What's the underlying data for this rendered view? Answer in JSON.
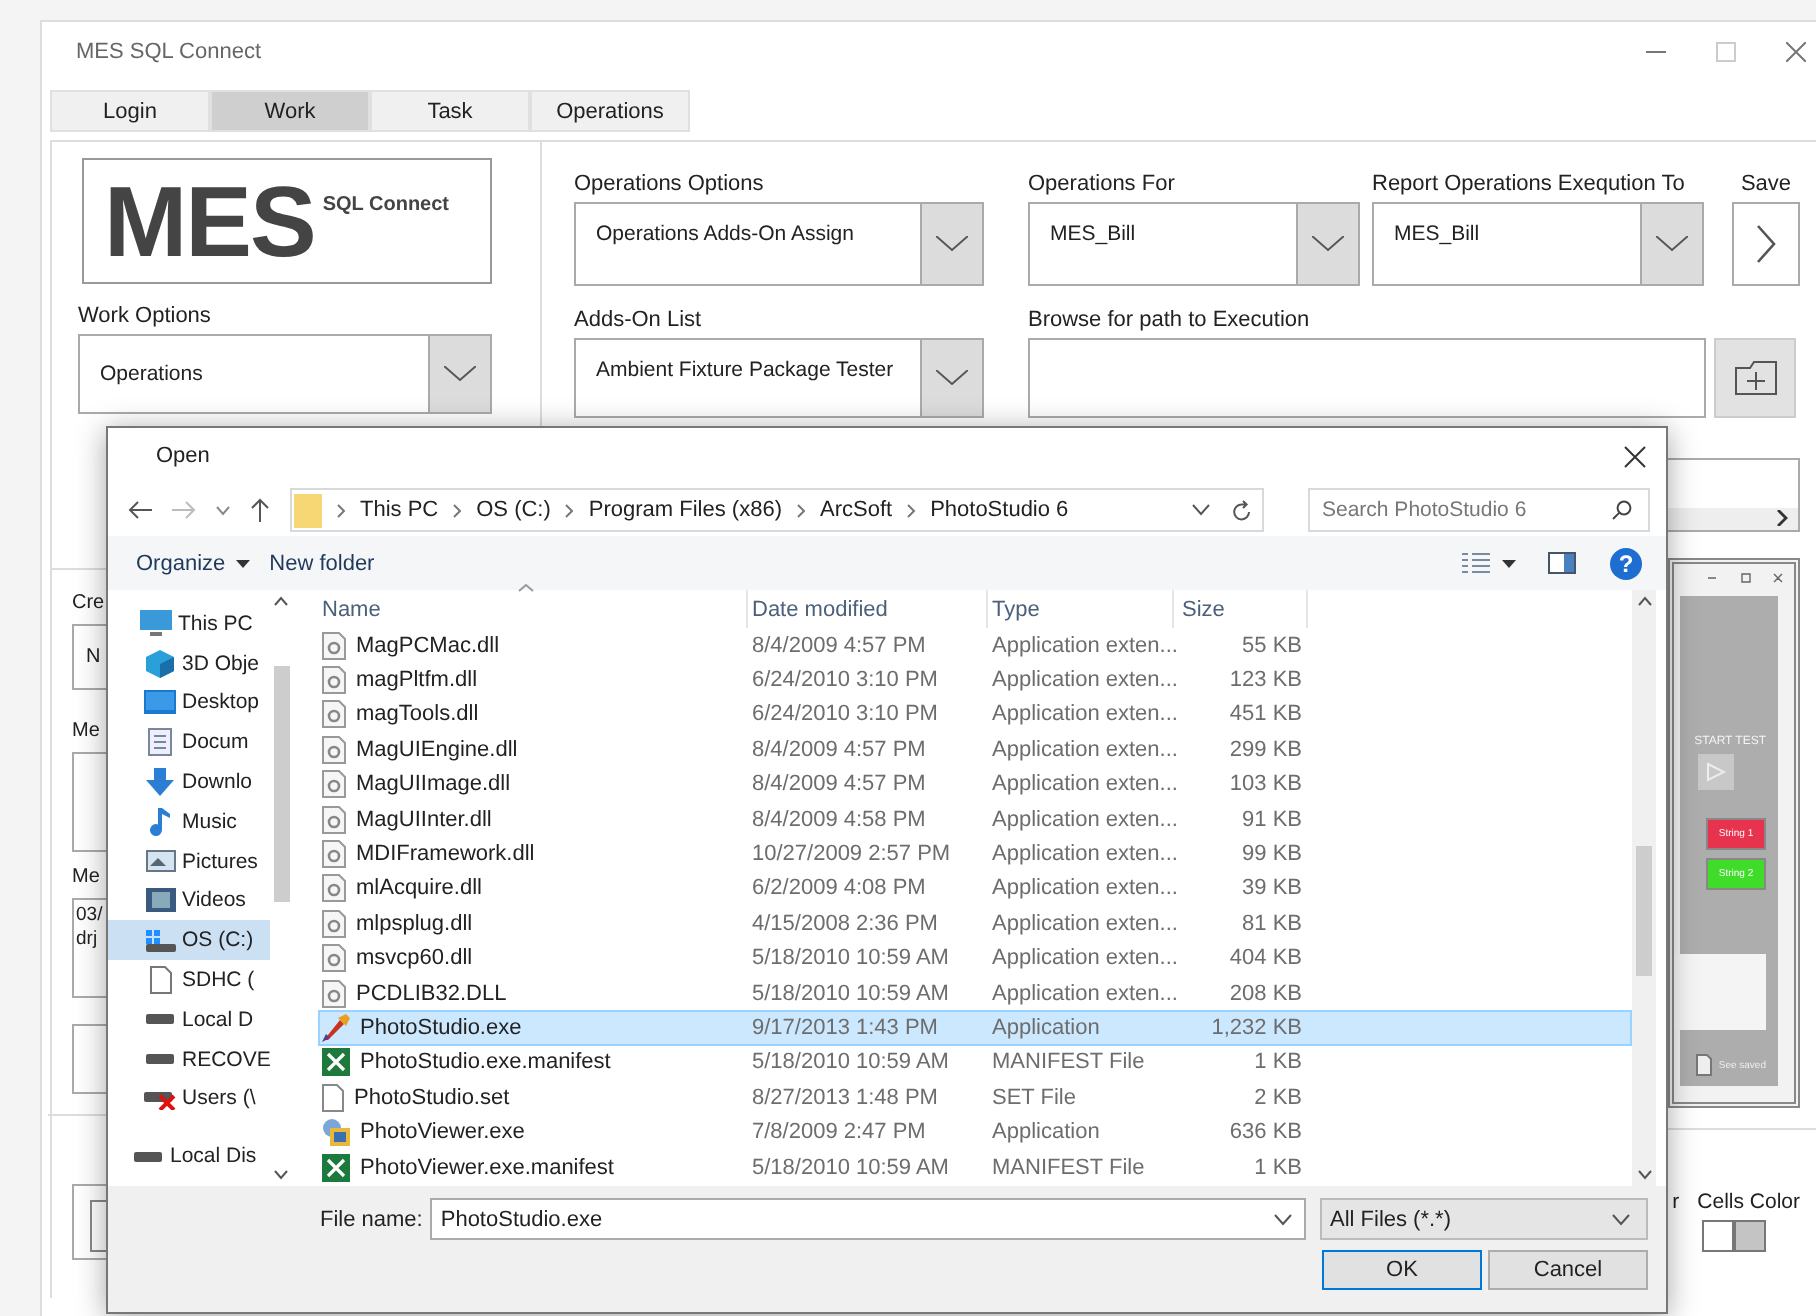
{
  "window": {
    "title": "MES SQL Connect"
  },
  "tabs": [
    {
      "label": "Login",
      "selected": false
    },
    {
      "label": "Work",
      "selected": true
    },
    {
      "label": "Task",
      "selected": false
    },
    {
      "label": "Operations",
      "selected": false
    }
  ],
  "logo": {
    "main": "MES",
    "sub": "SQL Connect"
  },
  "work_options": {
    "label": "Work Options",
    "value": "Operations"
  },
  "operations_options": {
    "label": "Operations Options",
    "value": "Operations Adds-On Assign"
  },
  "operations_for": {
    "label": "Operations For",
    "value": "MES_Bill"
  },
  "report_to": {
    "label": "Report Operations Exeqution To",
    "value": "MES_Bill"
  },
  "save": {
    "label": "Save"
  },
  "adds_on_list": {
    "label": "Adds-On List",
    "value": "Ambient Fixture Package Tester"
  },
  "browse": {
    "label": "Browse for path to Execution"
  },
  "left_fragments": {
    "label_1": "Cre",
    "field_1": "N",
    "label_2": "Me",
    "label_3": "Me",
    "field_3_lines": [
      "03/",
      "drj"
    ]
  },
  "preview_window": {
    "start_label": "START TEST",
    "buttons": [
      {
        "label": "String 1",
        "color": "#e8334f"
      },
      {
        "label": "String 2",
        "color": "#3fdc2a"
      }
    ],
    "saved_label": "See saved"
  },
  "cells_color": {
    "cut_label": "r",
    "label": "Cells Color",
    "swatches": [
      {
        "color": "#ffffff"
      },
      {
        "color": "#c4c4c4"
      }
    ]
  },
  "open_dialog": {
    "title": "Open",
    "breadcrumb": [
      "This PC",
      "OS (C:)",
      "Program Files (x86)",
      "ArcSoft",
      "PhotoStudio 6"
    ],
    "search": {
      "placeholder": "Search PhotoStudio 6"
    },
    "organize": "Organize",
    "new_folder": "New folder",
    "help": "?",
    "nav_items": [
      {
        "label": "This PC",
        "kind": "pc",
        "selected": false,
        "children": [
          {
            "label": "3D Obje",
            "kind": "cube",
            "selected": false
          },
          {
            "label": "Desktop",
            "kind": "desktop",
            "selected": false
          },
          {
            "label": "Docum",
            "kind": "document",
            "selected": false
          },
          {
            "label": "Downlo",
            "kind": "download",
            "selected": false
          },
          {
            "label": "Music",
            "kind": "music",
            "selected": false
          },
          {
            "label": "Pictures",
            "kind": "pictures",
            "selected": false
          },
          {
            "label": "Videos",
            "kind": "videos",
            "selected": false
          },
          {
            "label": "OS (C:)",
            "kind": "system-drive",
            "selected": true
          },
          {
            "label": "SDHC (",
            "kind": "card",
            "selected": false
          },
          {
            "label": "Local D",
            "kind": "drive",
            "selected": false
          },
          {
            "label": "RECOVE",
            "kind": "drive",
            "selected": false
          },
          {
            "label": "Users (\\",
            "kind": "drive-error",
            "selected": false
          }
        ]
      },
      {
        "label": "Local Dis",
        "kind": "drive",
        "selected": false
      }
    ],
    "columns": [
      "Name",
      "Date modified",
      "Type",
      "Size"
    ],
    "files": [
      {
        "name": "MagPCMac.dll",
        "date": "8/4/2009 4:57 PM",
        "type": "Application exten...",
        "size": "55 KB",
        "kind": "dll",
        "selected": false
      },
      {
        "name": "magPltfm.dll",
        "date": "6/24/2010 3:10 PM",
        "type": "Application exten...",
        "size": "123 KB",
        "kind": "dll",
        "selected": false
      },
      {
        "name": "magTools.dll",
        "date": "6/24/2010 3:10 PM",
        "type": "Application exten...",
        "size": "451 KB",
        "kind": "dll",
        "selected": false
      },
      {
        "name": "MagUIEngine.dll",
        "date": "8/4/2009 4:57 PM",
        "type": "Application exten...",
        "size": "299 KB",
        "kind": "dll",
        "selected": false
      },
      {
        "name": "MagUIImage.dll",
        "date": "8/4/2009 4:57 PM",
        "type": "Application exten...",
        "size": "103 KB",
        "kind": "dll",
        "selected": false
      },
      {
        "name": "MagUIInter.dll",
        "date": "8/4/2009 4:58 PM",
        "type": "Application exten...",
        "size": "91 KB",
        "kind": "dll",
        "selected": false
      },
      {
        "name": "MDIFramework.dll",
        "date": "10/27/2009 2:57 PM",
        "type": "Application exten...",
        "size": "99 KB",
        "kind": "dll",
        "selected": false
      },
      {
        "name": "mlAcquire.dll",
        "date": "6/2/2009 4:08 PM",
        "type": "Application exten...",
        "size": "39 KB",
        "kind": "dll",
        "selected": false
      },
      {
        "name": "mlpsplug.dll",
        "date": "4/15/2008 2:36 PM",
        "type": "Application exten...",
        "size": "81 KB",
        "kind": "dll",
        "selected": false
      },
      {
        "name": "msvcp60.dll",
        "date": "5/18/2010 10:59 AM",
        "type": "Application exten...",
        "size": "404 KB",
        "kind": "dll",
        "selected": false
      },
      {
        "name": "PCDLIB32.DLL",
        "date": "5/18/2010 10:59 AM",
        "type": "Application exten...",
        "size": "208 KB",
        "kind": "dll",
        "selected": false
      },
      {
        "name": "PhotoStudio.exe",
        "date": "9/17/2013 1:43 PM",
        "type": "Application",
        "size": "1,232 KB",
        "kind": "exe",
        "selected": true
      },
      {
        "name": "PhotoStudio.exe.manifest",
        "date": "5/18/2010 10:59 AM",
        "type": "MANIFEST File",
        "size": "1 KB",
        "kind": "manifest",
        "selected": false
      },
      {
        "name": "PhotoStudio.set",
        "date": "8/27/2013 1:48 PM",
        "type": "SET File",
        "size": "2 KB",
        "kind": "file",
        "selected": false
      },
      {
        "name": "PhotoViewer.exe",
        "date": "7/8/2009 2:47 PM",
        "type": "Application",
        "size": "636 KB",
        "kind": "viewer",
        "selected": false
      },
      {
        "name": "PhotoViewer.exe.manifest",
        "date": "5/18/2010 10:59 AM",
        "type": "MANIFEST File",
        "size": "1 KB",
        "kind": "manifest",
        "selected": false
      }
    ],
    "file_name": {
      "label": "File name:",
      "value": "PhotoStudio.exe"
    },
    "filter": "All Files (*.*)",
    "buttons": [
      {
        "label": "OK",
        "kind": "primary"
      },
      {
        "label": "Cancel",
        "kind": "secondary"
      }
    ]
  }
}
